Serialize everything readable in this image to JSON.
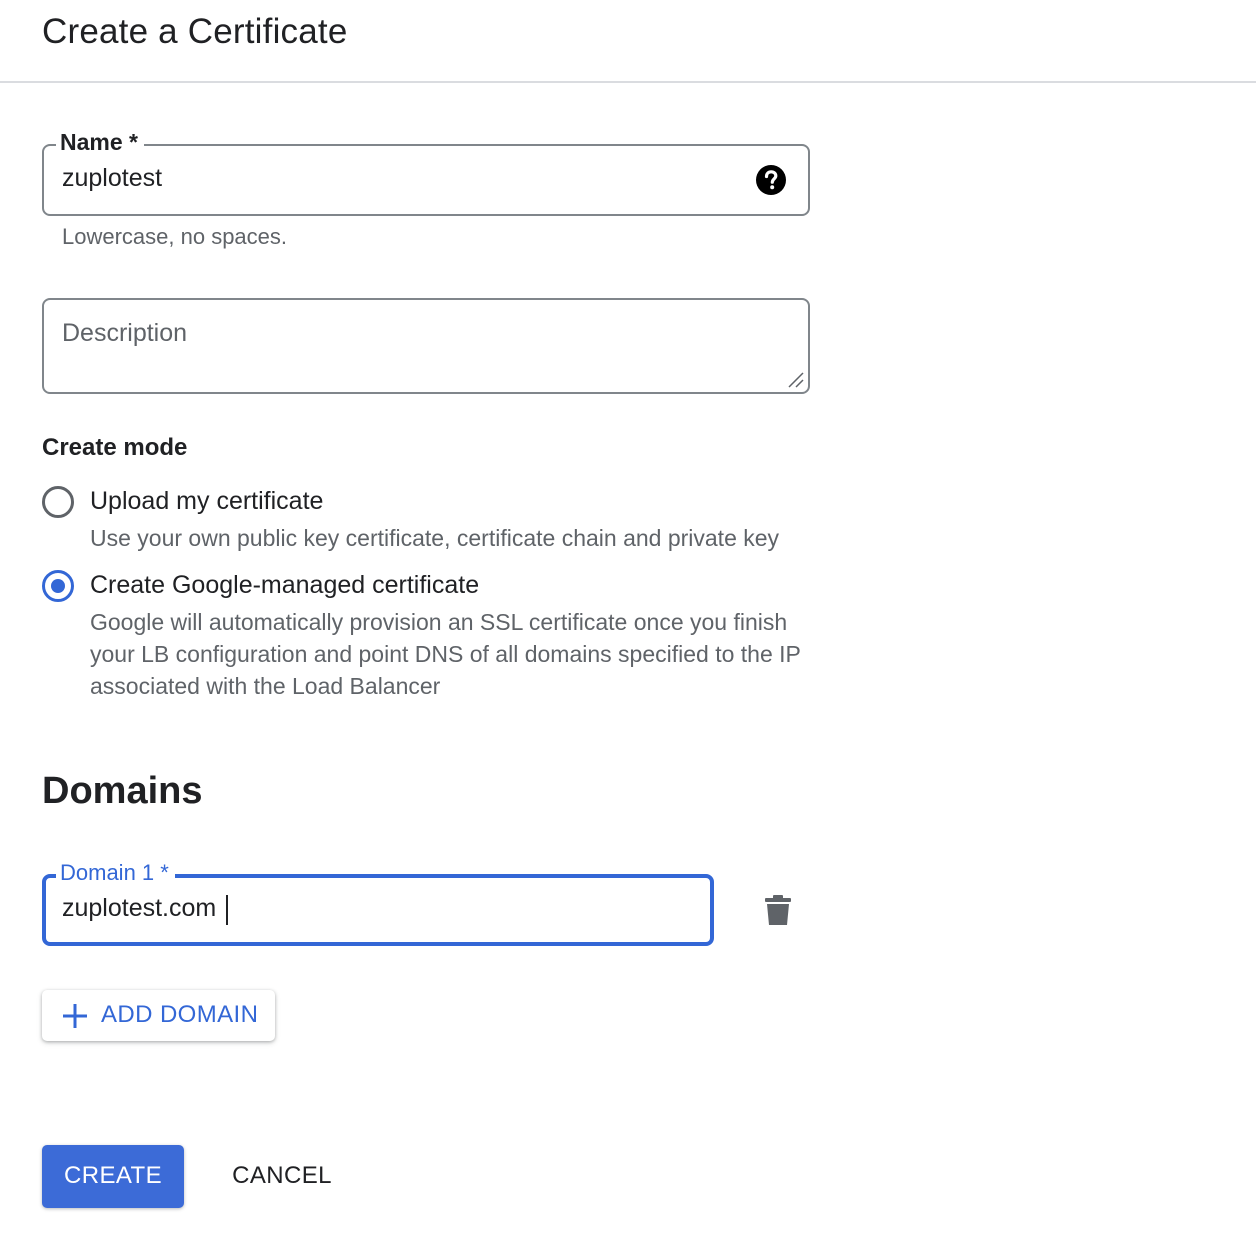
{
  "header": {
    "title": "Create a Certificate"
  },
  "name_field": {
    "label": "Name *",
    "value": "zuplotest",
    "hint": "Lowercase, no spaces.",
    "help_icon": "help-circle-icon"
  },
  "description_field": {
    "placeholder": "Description"
  },
  "create_mode": {
    "heading": "Create mode",
    "options": [
      {
        "label": "Upload my certificate",
        "description": "Use your own public key certificate, certificate chain and private key",
        "selected": false
      },
      {
        "label": "Create Google-managed certificate",
        "description": "Google will automatically provision an SSL certificate once you finish your LB configuration and point DNS of all domains specified to the IP associated with the Load Balancer",
        "selected": true
      }
    ]
  },
  "domains": {
    "heading": "Domains",
    "items": [
      {
        "label": "Domain 1 *",
        "value": "zuplotest.com"
      }
    ],
    "delete_icon": "trash-icon",
    "add_label": "ADD DOMAIN",
    "add_icon": "plus-icon"
  },
  "actions": {
    "create_label": "CREATE",
    "cancel_label": "CANCEL"
  },
  "colors": {
    "accent": "#3367d6",
    "border": "#80868b",
    "secondary_text": "#5f6368"
  }
}
